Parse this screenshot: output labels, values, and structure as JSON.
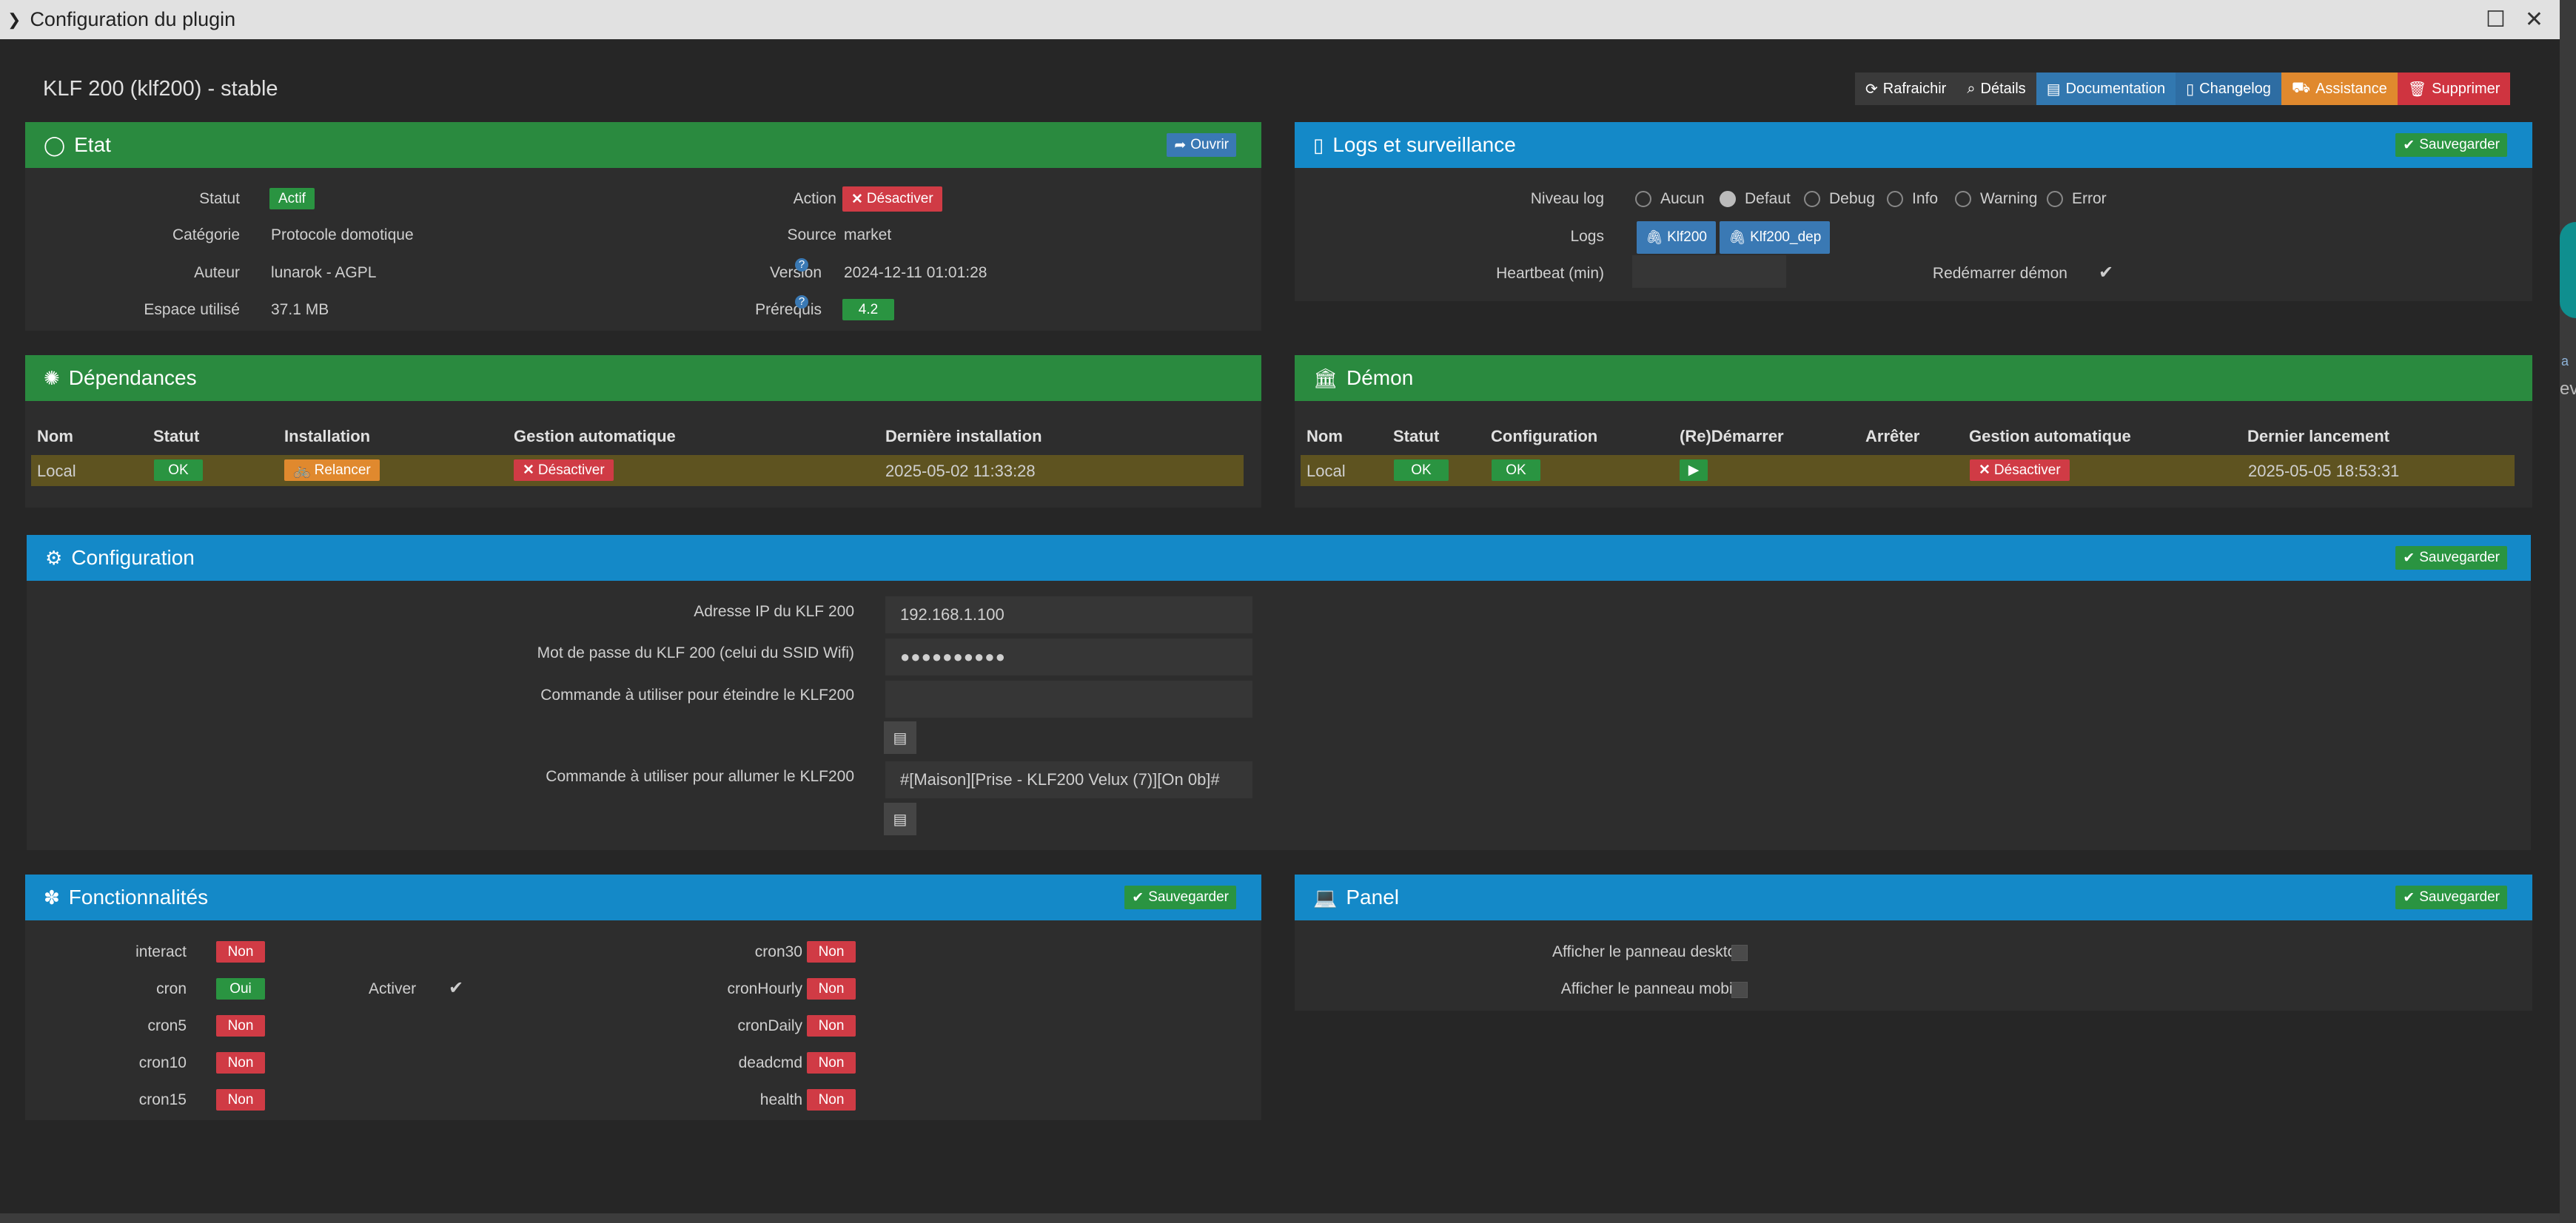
{
  "window": {
    "title": "Configuration du plugin",
    "chevron_icon": "chevron-right-icon",
    "maximize_icon": "maximize-icon",
    "close_icon": "close-icon"
  },
  "plugin": {
    "title": "KLF 200 (klf200) - stable"
  },
  "toolbar": {
    "refresh": "Rafraichir",
    "details": "Détails",
    "documentation": "Documentation",
    "changelog": "Changelog",
    "assistance": "Assistance",
    "delete": "Supprimer"
  },
  "etat": {
    "title": "Etat",
    "open_button": "Ouvrir",
    "statut_label": "Statut",
    "statut_value": "Actif",
    "categorie_label": "Catégorie",
    "categorie_value": "Protocole domotique",
    "auteur_label": "Auteur",
    "auteur_value": "lunarok - AGPL",
    "espace_label": "Espace utilisé",
    "espace_value": "37.1 MB",
    "action_label": "Action",
    "action_button": "Désactiver",
    "source_label": "Source",
    "source_value": "market",
    "version_label": "Version",
    "version_value": "2024-12-11 01:01:28",
    "prerequis_label": "Prérequis",
    "prerequis_value": "4.2"
  },
  "logs": {
    "title": "Logs et surveillance",
    "save_button": "Sauvegarder",
    "niveau_label": "Niveau log",
    "levels": [
      "Aucun",
      "Defaut",
      "Debug",
      "Info",
      "Warning",
      "Error"
    ],
    "selected_level": "Defaut",
    "logs_label": "Logs",
    "log_buttons": [
      "Klf200",
      "Klf200_dep"
    ],
    "heartbeat_label": "Heartbeat (min)",
    "heartbeat_value": "",
    "restart_label": "Redémarrer démon",
    "restart_checked": true
  },
  "dependances": {
    "title": "Dépendances",
    "columns": [
      "Nom",
      "Statut",
      "Installation",
      "Gestion automatique",
      "Dernière installation"
    ],
    "row": {
      "nom": "Local",
      "statut": "OK",
      "installation": "Relancer",
      "gestion": "Désactiver",
      "derniere": "2025-05-02 11:33:28"
    }
  },
  "demon": {
    "title": "Démon",
    "columns": [
      "Nom",
      "Statut",
      "Configuration",
      "(Re)Démarrer",
      "Arrêter",
      "Gestion automatique",
      "Dernier lancement"
    ],
    "row": {
      "nom": "Local",
      "statut": "OK",
      "configuration": "OK",
      "gestion": "Désactiver",
      "dernier": "2025-05-05 18:53:31"
    }
  },
  "configuration": {
    "title": "Configuration",
    "save_button": "Sauvegarder",
    "ip_label": "Adresse IP du KLF 200",
    "ip_value": "192.168.1.100",
    "pwd_label": "Mot de passe du KLF 200 (celui du SSID Wifi)",
    "pwd_value": "●●●●●●●●●●",
    "off_label": "Commande à utiliser pour éteindre le KLF200",
    "off_value": "",
    "on_label": "Commande à utiliser pour allumer le KLF200",
    "on_value": "#[Maison][Prise - KLF200 Velux (7)][On 0b]#"
  },
  "fonctionnalites": {
    "title": "Fonctionnalités",
    "save_button": "Sauvegarder",
    "left": [
      {
        "name": "interact",
        "value": "Non"
      },
      {
        "name": "cron",
        "value": "Oui"
      },
      {
        "name": "cron5",
        "value": "Non"
      },
      {
        "name": "cron10",
        "value": "Non"
      },
      {
        "name": "cron15",
        "value": "Non"
      }
    ],
    "activer_label": "Activer",
    "right": [
      {
        "name": "cron30",
        "value": "Non"
      },
      {
        "name": "cronHourly",
        "value": "Non"
      },
      {
        "name": "cronDaily",
        "value": "Non"
      },
      {
        "name": "deadcmd",
        "value": "Non"
      },
      {
        "name": "health",
        "value": "Non"
      }
    ]
  },
  "panel": {
    "title": "Panel",
    "save_button": "Sauvegarder",
    "desktop_label": "Afficher le panneau desktop",
    "mobile_label": "Afficher le panneau mobile"
  },
  "sidebar_peek": {
    "text1": "a",
    "text2": "ev"
  },
  "colors": {
    "green": "#2a8a3f",
    "blue": "#1489c8",
    "red": "#d03b45",
    "orange": "#e0892e"
  }
}
